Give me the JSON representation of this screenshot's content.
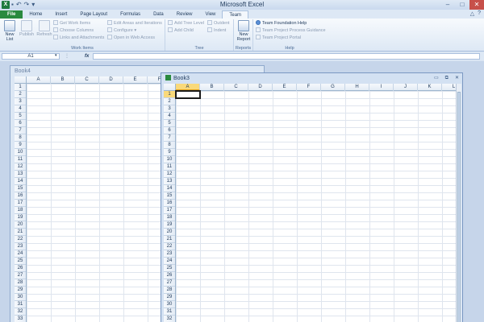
{
  "app": {
    "title": "Microsoft Excel",
    "icon_letter": "X"
  },
  "tabs": [
    "File",
    "Home",
    "Insert",
    "Page Layout",
    "Formulas",
    "Data",
    "Review",
    "View",
    "Team"
  ],
  "active_tab": "Team",
  "ribbon": {
    "groups": [
      {
        "label": "Work Items"
      },
      {
        "label": "Tree"
      },
      {
        "label": "Reports"
      },
      {
        "label": "Help"
      }
    ],
    "new_list": "New List",
    "publish": "Publish",
    "refresh": "Refresh",
    "get_work_items": "Get Work Items",
    "choose_columns": "Choose Columns",
    "links_attachments": "Links and Attachments",
    "edit_areas": "Edit Areas and Iterations",
    "configure": "Configure",
    "open_web_access": "Open in Web Access",
    "add_tree_level": "Add Tree Level",
    "add_child": "Add Child",
    "outdent": "Outdent",
    "indent": "Indent",
    "new_report": "New Report",
    "tf_help": "Team Foundation Help",
    "process_guidance": "Team Project Process Guidance",
    "project_portal": "Team Project Portal"
  },
  "formula_bar": {
    "name_box": "A1",
    "fx": "fx",
    "value": ""
  },
  "book4": {
    "title": "Book4",
    "columns": [
      "A",
      "B",
      "C",
      "D",
      "E",
      "F"
    ],
    "rows": [
      "1",
      "2",
      "3",
      "4",
      "5",
      "6",
      "7",
      "8",
      "9",
      "10",
      "11",
      "12",
      "13",
      "14",
      "15",
      "16",
      "17",
      "18",
      "19",
      "20",
      "21",
      "22",
      "23",
      "24",
      "25",
      "26",
      "27",
      "28",
      "29",
      "30",
      "31",
      "32",
      "33"
    ]
  },
  "book3": {
    "title": "Book3",
    "columns": [
      "A",
      "B",
      "C",
      "D",
      "E",
      "F",
      "G",
      "H",
      "I",
      "J",
      "K",
      "L"
    ],
    "rows": [
      "1",
      "2",
      "3",
      "4",
      "5",
      "6",
      "7",
      "8",
      "9",
      "10",
      "11",
      "12",
      "13",
      "14",
      "15",
      "16",
      "17",
      "18",
      "19",
      "20",
      "21",
      "22",
      "23",
      "24",
      "25",
      "26",
      "27",
      "28",
      "29",
      "30",
      "31",
      "32"
    ],
    "active_cell": "A1"
  }
}
